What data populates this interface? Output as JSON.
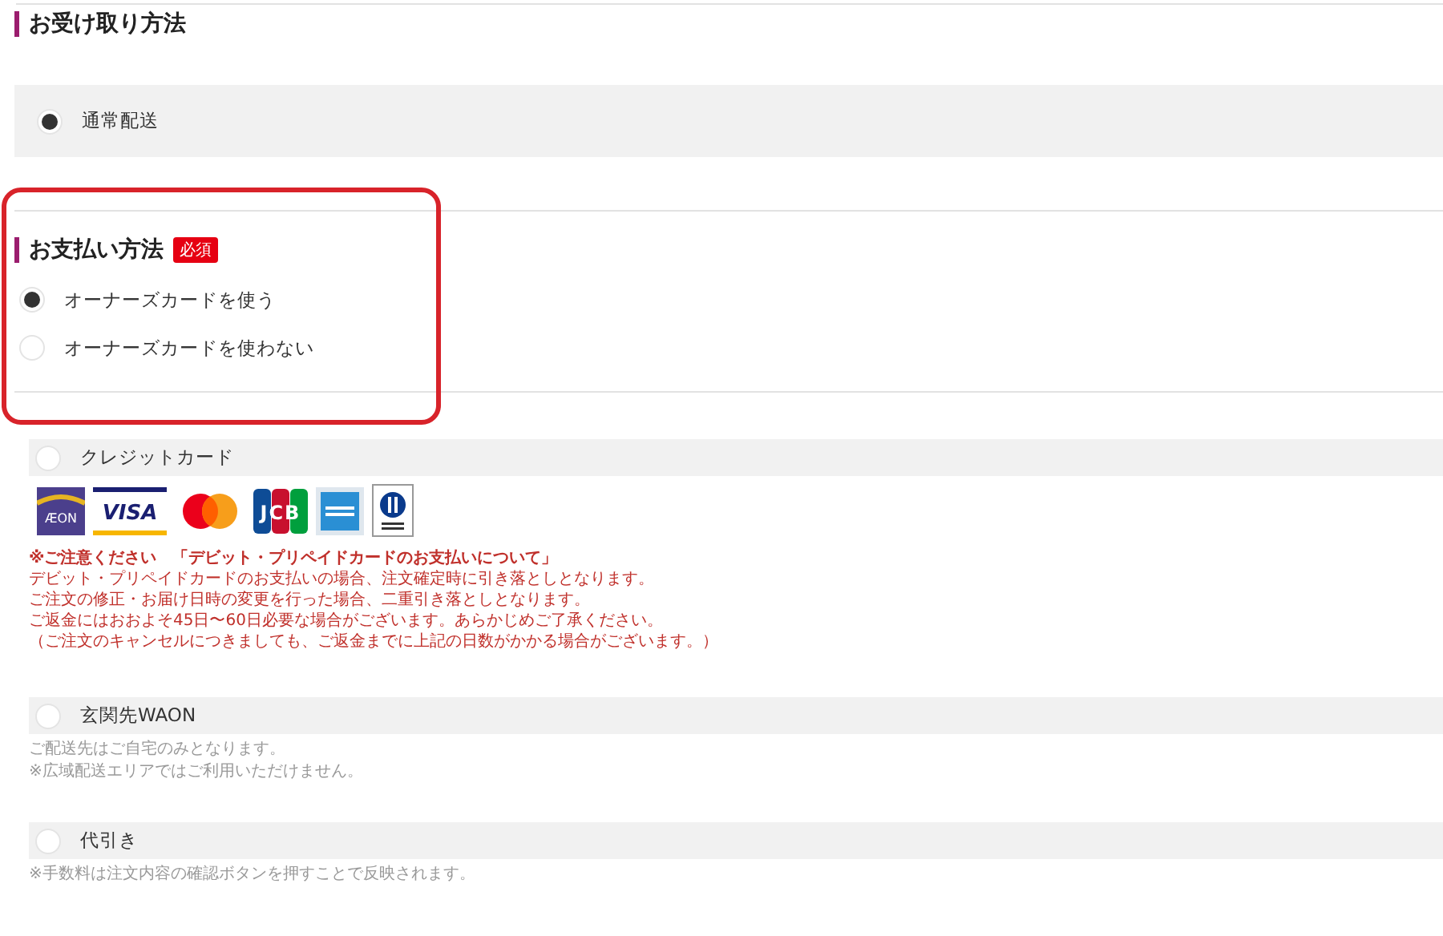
{
  "receipt": {
    "title": "お受け取り方法",
    "options": [
      {
        "label": "通常配送",
        "selected": true
      }
    ]
  },
  "owner_card": {
    "title": "お支払い方法",
    "badge": "必須",
    "highlighted": true,
    "options": [
      {
        "label": "オーナーズカードを使う",
        "selected": true
      },
      {
        "label": "オーナーズカードを使わない",
        "selected": false
      }
    ]
  },
  "payment_methods": [
    {
      "label": "クレジットカード",
      "selected": false,
      "cards": [
        {
          "kind": "aeon",
          "label": "ÆON"
        },
        {
          "kind": "visa",
          "label": "VISA"
        },
        {
          "kind": "mastercard"
        },
        {
          "kind": "jcb",
          "label": "JCB"
        },
        {
          "kind": "amex"
        },
        {
          "kind": "diners"
        }
      ],
      "notice": {
        "title": "※ご注意ください　「デビット・プリペイドカードのお支払いについて」",
        "lines": [
          "デビット・プリペイドカードのお支払いの場合、注文確定時に引き落としとなります。",
          "ご注文の修正・お届け日時の変更を行った場合、二重引き落としとなります。",
          "ご返金にはおおよそ45日〜60日必要な場合がございます。あらかじめご了承ください。",
          "（ご注文のキャンセルにつきましても、ご返金までに上記の日数がかかる場合がございます。）"
        ]
      }
    },
    {
      "label": "玄関先WAON",
      "selected": false,
      "notes": [
        "ご配送先はご自宅のみとなります。",
        "※広域配送エリアではご利用いただけません。"
      ]
    },
    {
      "label": "代引き",
      "selected": false,
      "notes": [
        "※手数料は注文内容の確認ボタンを押すことで反映されます。"
      ]
    }
  ]
}
